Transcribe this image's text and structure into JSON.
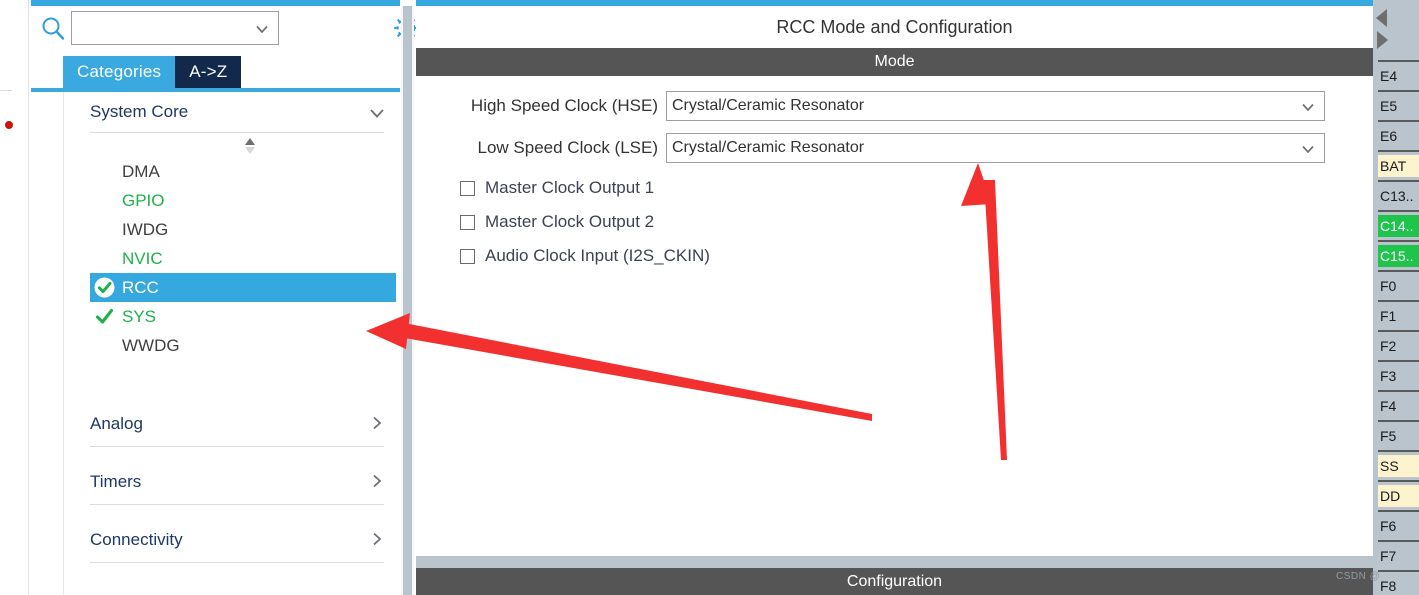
{
  "theme": {
    "accent_blue": "#36a9e1",
    "tab_dark": "#13294b",
    "section_gray": "#555555",
    "panel_gray": "#b9c4cc",
    "selected_blue": "#35a8e0",
    "green_text": "#1fb14a",
    "annotation_red": "#f23030",
    "power_pin": "#fdf3cf",
    "active_pin": "#1fc44d"
  },
  "sidebar": {
    "search": {
      "icon": "search-icon",
      "value": "",
      "placeholder": "",
      "dropdown_icon": "chevron-down-icon"
    },
    "settings_icon": "gear-icon",
    "tabs": [
      {
        "label": "Categories",
        "active": true
      },
      {
        "label": "A->Z",
        "active": false
      }
    ],
    "groups": [
      {
        "label": "System Core",
        "expanded": true,
        "chevron": "chevron-down-icon",
        "sort_icon": "sort-arrows-icon",
        "items": [
          {
            "label": "DMA",
            "state": "none",
            "color": "#404040"
          },
          {
            "label": "GPIO",
            "state": "none",
            "color": "#1fb14a"
          },
          {
            "label": "IWDG",
            "state": "none",
            "color": "#404040"
          },
          {
            "label": "NVIC",
            "state": "none",
            "color": "#1fb14a"
          },
          {
            "label": "RCC",
            "state": "configured",
            "color": "#ffffff",
            "selected": true
          },
          {
            "label": "SYS",
            "state": "checked",
            "color": "#1fb14a"
          },
          {
            "label": "WWDG",
            "state": "none",
            "color": "#404040"
          }
        ]
      },
      {
        "label": "Analog",
        "expanded": false,
        "chevron": "chevron-right-icon"
      },
      {
        "label": "Timers",
        "expanded": false,
        "chevron": "chevron-right-icon"
      },
      {
        "label": "Connectivity",
        "expanded": false,
        "chevron": "chevron-right-icon"
      }
    ]
  },
  "main": {
    "title": "RCC Mode and Configuration",
    "mode_section": "Mode",
    "configuration_section": "Configuration",
    "rows": [
      {
        "label": "High Speed Clock (HSE)",
        "value": "Crystal/Ceramic Resonator",
        "dropdown_icon": "chevron-down-icon"
      },
      {
        "label": "Low Speed Clock (LSE)",
        "value": "Crystal/Ceramic Resonator",
        "dropdown_icon": "chevron-down-icon"
      }
    ],
    "checkboxes": [
      {
        "label": "Master Clock Output 1",
        "checked": false
      },
      {
        "label": "Master Clock Output 2",
        "checked": false
      },
      {
        "label": "Audio Clock Input (I2S_CKIN)",
        "checked": false
      }
    ]
  },
  "pin_strip": {
    "nav_left_icon": "triangle-left-icon",
    "nav_right_icon": "triangle-right-icon",
    "pins": [
      {
        "label": "E4",
        "type": "normal"
      },
      {
        "label": "E5",
        "type": "normal"
      },
      {
        "label": "E6",
        "type": "normal"
      },
      {
        "label": "BAT",
        "type": "power"
      },
      {
        "label": "C13..",
        "type": "normal"
      },
      {
        "label": "C14..",
        "type": "active"
      },
      {
        "label": "C15..",
        "type": "active"
      },
      {
        "label": "F0",
        "type": "normal"
      },
      {
        "label": "F1",
        "type": "normal"
      },
      {
        "label": "F2",
        "type": "normal"
      },
      {
        "label": "F3",
        "type": "normal"
      },
      {
        "label": "F4",
        "type": "normal"
      },
      {
        "label": "F5",
        "type": "normal"
      },
      {
        "label": "SS",
        "type": "power"
      },
      {
        "label": "DD",
        "type": "power"
      },
      {
        "label": "F6",
        "type": "normal"
      },
      {
        "label": "F7",
        "type": "normal"
      },
      {
        "label": "F8",
        "type": "normal"
      }
    ]
  },
  "annotations": {
    "arrow_to_rcc": "red-arrow-left",
    "arrow_to_mode": "red-arrow-up"
  },
  "watermark": "CSDN @"
}
